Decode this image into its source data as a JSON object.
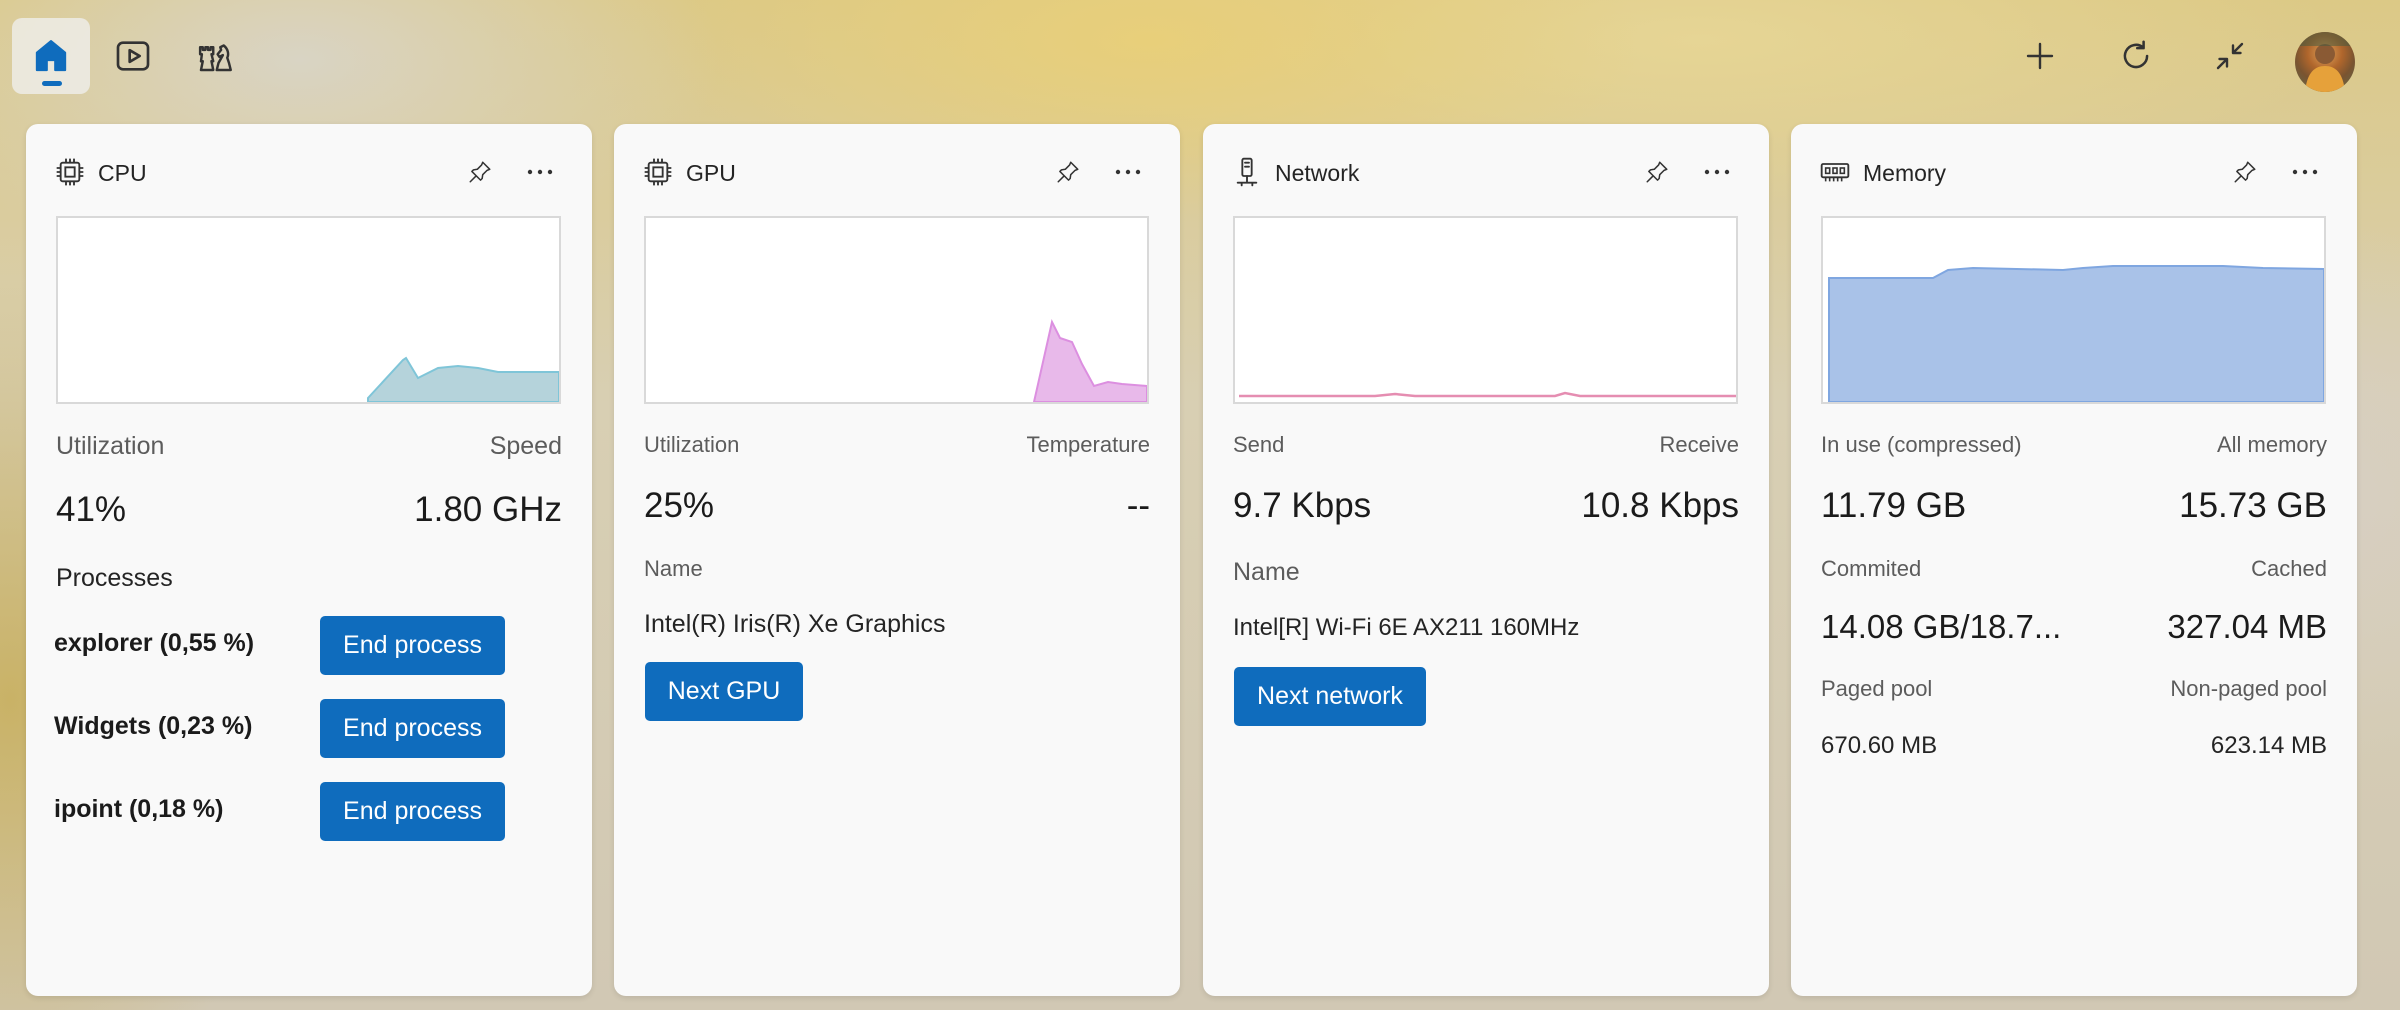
{
  "nav": {
    "tabs": [
      {
        "icon": "home-icon",
        "active": true
      },
      {
        "icon": "play-icon",
        "active": false
      },
      {
        "icon": "game-pieces-icon",
        "active": false
      }
    ],
    "actions": [
      "add-icon",
      "refresh-icon",
      "collapse-icon"
    ]
  },
  "colors": {
    "accent": "#0f6cbd",
    "cpu_chart": "#a9cdd6",
    "gpu_chart": "#e3aee6",
    "network_chart": "#e89ab8",
    "memory_chart": "#a8c1e6"
  },
  "cpu": {
    "title": "CPU",
    "util_label": "Utilization",
    "speed_label": "Speed",
    "util_value": "41%",
    "speed_value": "1.80 GHz",
    "processes_label": "Processes",
    "processes": [
      {
        "name": "explorer (0,55 %)",
        "button": "End process"
      },
      {
        "name": "Widgets (0,23 %)",
        "button": "End process"
      },
      {
        "name": "ipoint (0,18 %)",
        "button": "End process"
      }
    ]
  },
  "gpu": {
    "title": "GPU",
    "util_label": "Utilization",
    "temp_label": "Temperature",
    "util_value": "25%",
    "temp_value": "--",
    "name_label": "Name",
    "name_value": "Intel(R) Iris(R) Xe Graphics",
    "next_button": "Next GPU"
  },
  "network": {
    "title": "Network",
    "send_label": "Send",
    "receive_label": "Receive",
    "send_value": "9.7 Kbps",
    "receive_value": "10.8 Kbps",
    "name_label": "Name",
    "name_value": "Intel[R] Wi-Fi 6E AX211 160MHz",
    "next_button": "Next network"
  },
  "memory": {
    "title": "Memory",
    "in_use_label": "In use (compressed)",
    "all_label": "All memory",
    "in_use_value": "11.79 GB",
    "all_value": "15.73 GB",
    "committed_label": "Commited",
    "cached_label": "Cached",
    "committed_value": "14.08 GB/18.7...",
    "cached_value": "327.04 MB",
    "paged_label": "Paged pool",
    "nonpaged_label": "Non-paged pool",
    "paged_value": "670.60 MB",
    "nonpaged_value": "623.14 MB"
  }
}
